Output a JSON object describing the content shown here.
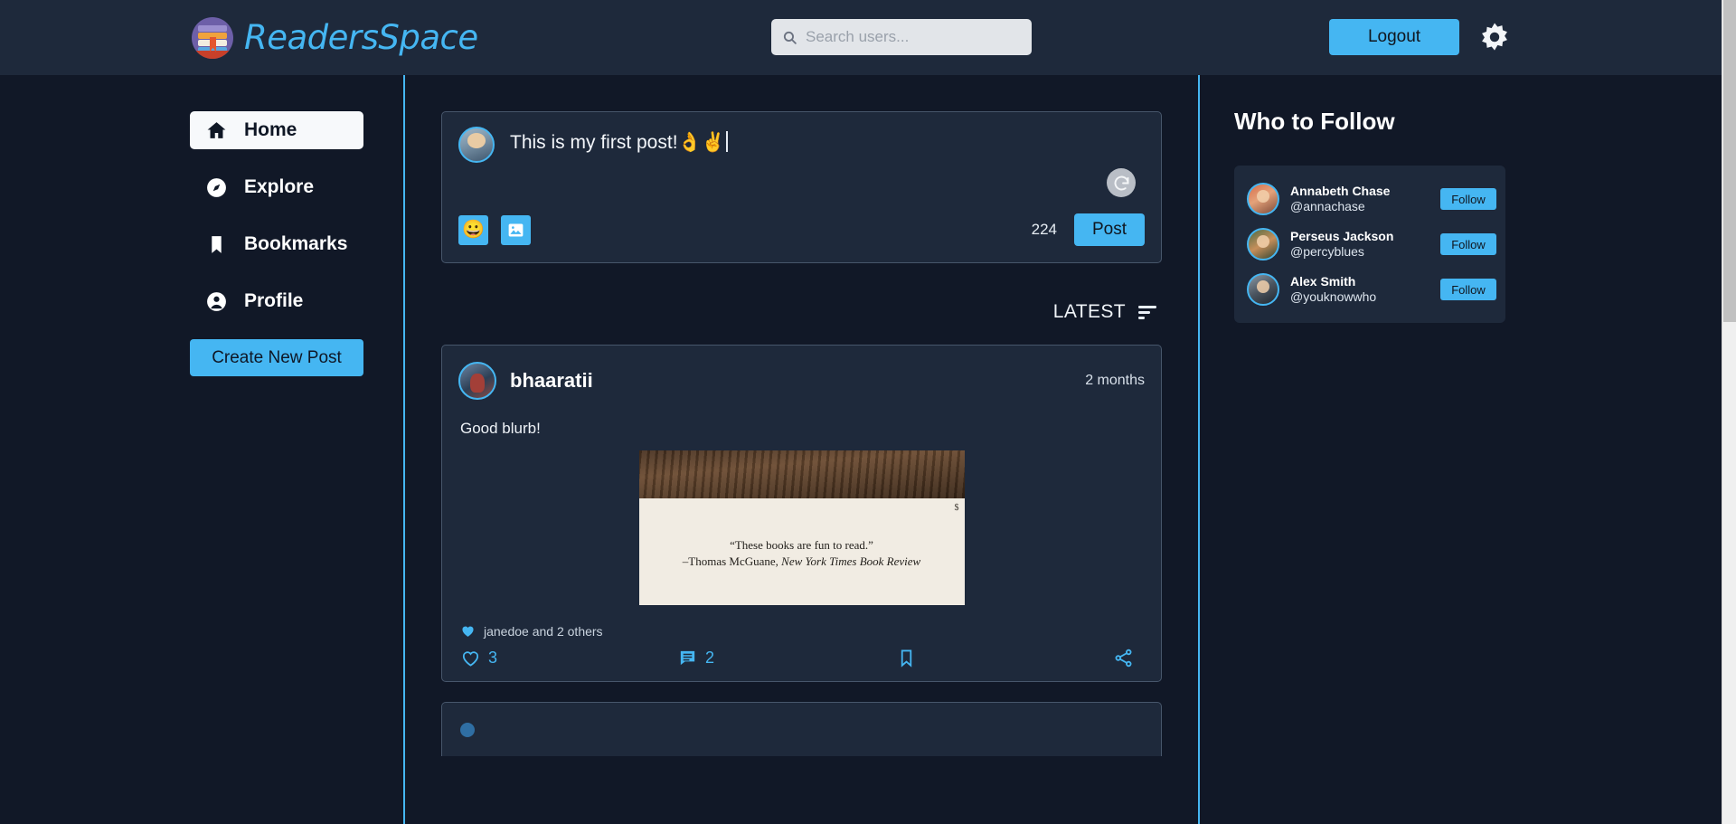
{
  "header": {
    "brand_name": "ReadersSpace",
    "logo_icon": "books-stack-icon",
    "search": {
      "icon": "search-icon",
      "placeholder": "Search users...",
      "value": ""
    },
    "logout_label": "Logout",
    "settings_icon": "gear-icon"
  },
  "sidebar": {
    "items": [
      {
        "label": "Home",
        "icon": "home-icon",
        "active": true
      },
      {
        "label": "Explore",
        "icon": "compass-icon",
        "active": false
      },
      {
        "label": "Bookmarks",
        "icon": "bookmark-icon",
        "active": false
      },
      {
        "label": "Profile",
        "icon": "person-icon",
        "active": false
      }
    ],
    "create_post_label": "Create New Post"
  },
  "compose": {
    "avatar_name": "current-user-avatar",
    "text": "This is my first post!👌✌",
    "emoji_button_icon": "emoji-smile-icon",
    "image_button_icon": "image-upload-icon",
    "spinner_icon": "progress-spinner-icon",
    "char_count": "224",
    "post_label": "Post"
  },
  "feed": {
    "sort_label": "LATEST",
    "sort_icon": "sort-descending-icon",
    "posts": [
      {
        "username": "bhaaratii",
        "time": "2 months",
        "body": "Good blurb!",
        "media": {
          "alt": "photo-of-book-back-cover-quote",
          "quote": "“These books are fun to read.”",
          "attribution_dash": "–Thomas McGuane, ",
          "attribution_source": "New York Times Book Review",
          "corner_mark": "$"
        },
        "likes_summary": "janedoe and 2 others",
        "like_count": "3",
        "comment_count": "2",
        "like_icon": "heart-outline-icon",
        "comment_icon": "comment-icon",
        "bookmark_icon": "bookmark-outline-icon",
        "share_icon": "share-icon"
      }
    ]
  },
  "right_panel": {
    "title": "Who to Follow",
    "suggestions": [
      {
        "name": "Annabeth Chase",
        "handle": "@annachase",
        "action": "Follow"
      },
      {
        "name": "Perseus Jackson",
        "handle": "@percyblues",
        "action": "Follow"
      },
      {
        "name": "Alex Smith",
        "handle": "@youknowwho",
        "action": "Follow"
      }
    ]
  },
  "colors": {
    "accent": "#45b6f2",
    "header_bg": "#1e293b",
    "page_bg": "#111827",
    "card_bg": "#1e293b",
    "card_border": "#47566b"
  }
}
